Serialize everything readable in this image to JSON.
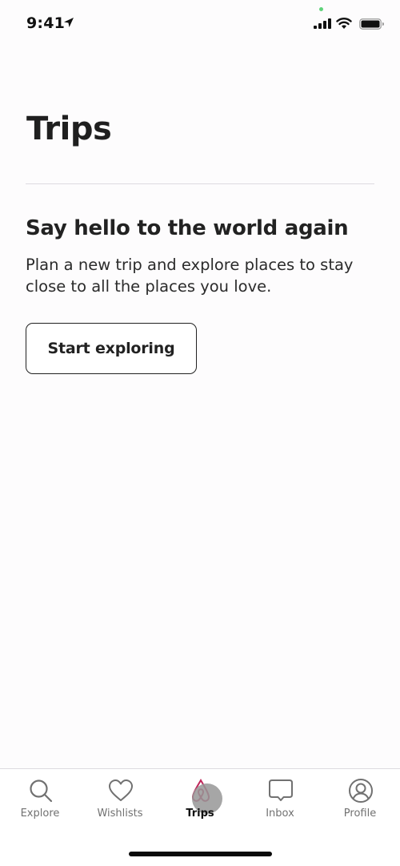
{
  "status_bar": {
    "time": "9:41",
    "icons": [
      "location-arrow-icon",
      "signal-icon",
      "wifi-icon",
      "battery-icon"
    ],
    "privacy_dot_color": "#5fd37a"
  },
  "page": {
    "title": "Trips"
  },
  "empty_state": {
    "headline": "Say hello to the world again",
    "description": "Plan a new trip and explore places to stay close to all the places you love.",
    "button_label": "Start exploring"
  },
  "tab_bar": {
    "active_tab": "Trips",
    "accent_color": "#c0265a",
    "tabs": [
      {
        "label": "Explore",
        "icon": "search-icon"
      },
      {
        "label": "Wishlists",
        "icon": "heart-icon"
      },
      {
        "label": "Trips",
        "icon": "airbnb-logo-icon"
      },
      {
        "label": "Inbox",
        "icon": "message-icon"
      },
      {
        "label": "Profile",
        "icon": "profile-icon"
      }
    ]
  }
}
